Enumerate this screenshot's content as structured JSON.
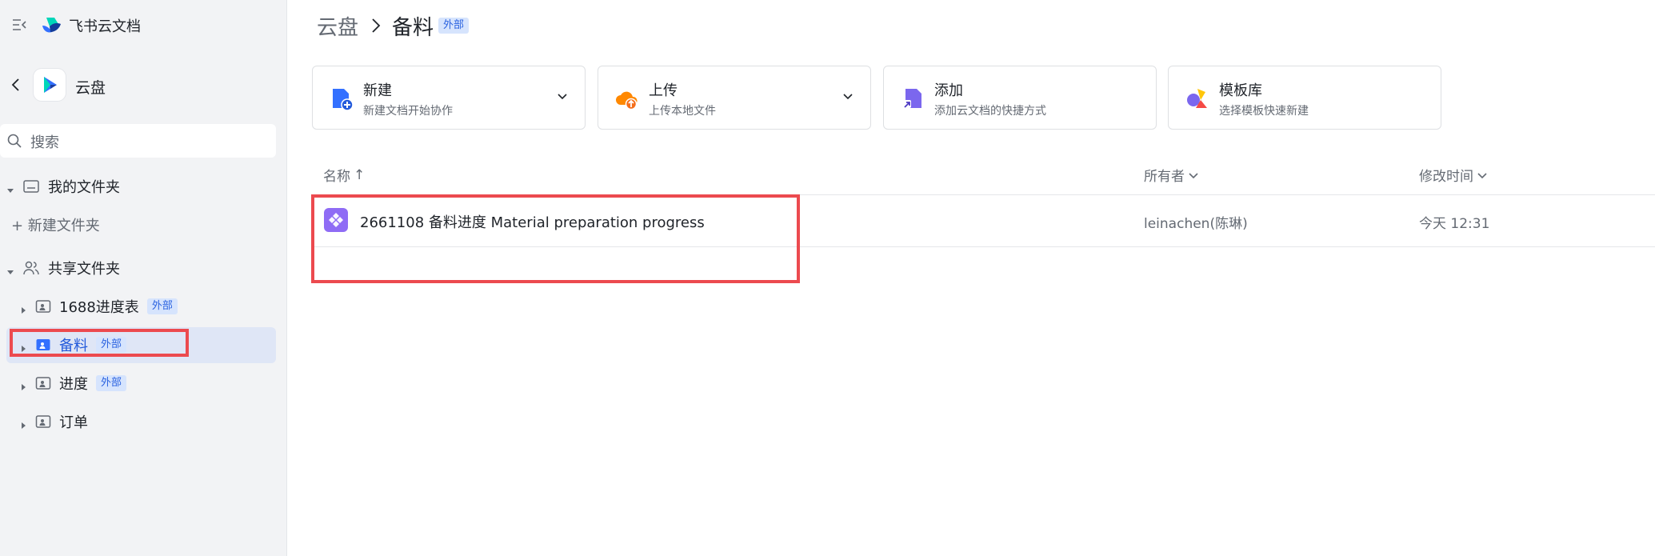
{
  "app": {
    "title": "飞书云文档"
  },
  "sidebar": {
    "space_title": "云盘",
    "search_placeholder": "搜索",
    "my_folder": "我的文件夹",
    "new_folder": "+ 新建文件夹",
    "shared_folder": "共享文件夹",
    "items": [
      {
        "label": "1688进度表",
        "badge": "外部"
      },
      {
        "label": "备料",
        "badge": "外部"
      },
      {
        "label": "进度",
        "badge": "外部"
      },
      {
        "label": "订单",
        "badge": ""
      }
    ]
  },
  "breadcrumb": {
    "root": "云盘",
    "current": "备料",
    "badge": "外部"
  },
  "actions": [
    {
      "title": "新建",
      "subtitle": "新建文档开始协作"
    },
    {
      "title": "上传",
      "subtitle": "上传本地文件"
    },
    {
      "title": "添加",
      "subtitle": "添加云文档的快捷方式"
    },
    {
      "title": "模板库",
      "subtitle": "选择模板快速新建"
    }
  ],
  "table": {
    "columns": {
      "name": "名称",
      "name_sort": "↑",
      "owner": "所有者",
      "modified": "修改时间"
    },
    "rows": [
      {
        "name": "2661108 备料进度 Material preparation progress",
        "owner": "leinachen(陈琳)",
        "modified": "今天 12:31"
      }
    ]
  },
  "colors": {
    "accent": "#3370ff",
    "highlight": "#ec4a4f",
    "selected_bg": "#dfe6f6"
  }
}
